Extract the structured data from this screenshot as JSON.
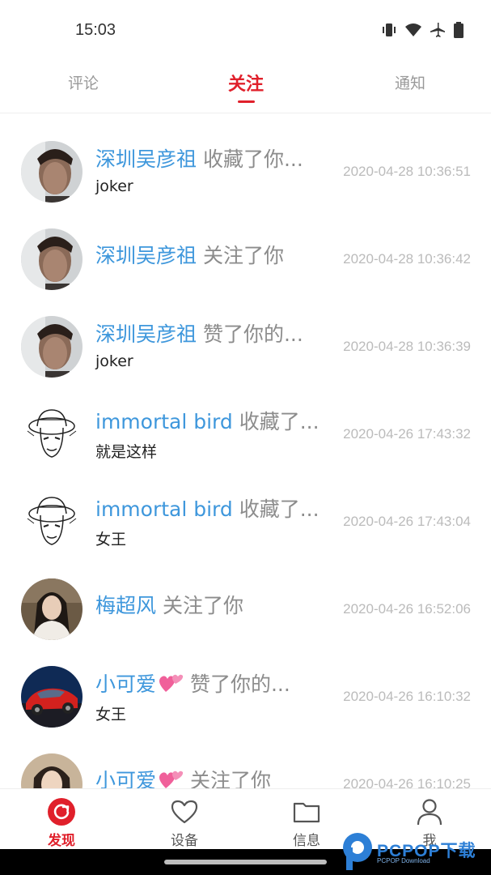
{
  "status_bar": {
    "time": "15:03",
    "icons": [
      "vibrate-icon",
      "wifi-icon",
      "airplane-icon",
      "battery-icon"
    ]
  },
  "tabs": [
    {
      "label": "评论",
      "active": false
    },
    {
      "label": "关注",
      "active": true
    },
    {
      "label": "通知",
      "active": false
    }
  ],
  "items": [
    {
      "avatar": "man-portrait",
      "name": "深圳吴彦祖",
      "action": "收藏了你...",
      "sub": "joker",
      "time": "2020-04-28 10:36:51"
    },
    {
      "avatar": "man-portrait",
      "name": "深圳吴彦祖",
      "action": "关注了你",
      "sub": "",
      "time": "2020-04-28 10:36:42"
    },
    {
      "avatar": "man-portrait",
      "name": "深圳吴彦祖",
      "action": "赞了你的...",
      "sub": "joker",
      "time": "2020-04-28 10:36:39"
    },
    {
      "avatar": "straw-hat-sketch",
      "name": "immortal bird",
      "action": "收藏了...",
      "sub": "就是这样",
      "time": "2020-04-26 17:43:32"
    },
    {
      "avatar": "straw-hat-sketch",
      "name": "immortal bird",
      "action": "收藏了...",
      "sub": "女王",
      "time": "2020-04-26 17:43:04"
    },
    {
      "avatar": "woman-portrait",
      "name": "梅超风",
      "action": "关注了你",
      "sub": "",
      "time": "2020-04-26 16:52:06"
    },
    {
      "avatar": "red-sports-car",
      "name": "小可爱",
      "name_emoji": "two-hearts",
      "action": "赞了你的...",
      "sub": "女王",
      "time": "2020-04-26 16:10:32"
    },
    {
      "avatar": "woman-portrait-2",
      "name": "小可爱",
      "name_emoji": "two-hearts",
      "action": "关注了你",
      "sub": "",
      "time": "2020-04-26 16:10:25"
    }
  ],
  "bottom_nav": [
    {
      "label": "发现",
      "icon": "refresh-icon",
      "active": true
    },
    {
      "label": "设备",
      "icon": "heart-icon",
      "active": false
    },
    {
      "label": "信息",
      "icon": "folder-icon",
      "active": false
    },
    {
      "label": "我",
      "icon": "user-icon",
      "active": false
    }
  ],
  "watermark": {
    "text": "PCPOP下载",
    "sub": "PCPOP Download"
  },
  "colors": {
    "accent": "#e0202b",
    "username": "#3e97dc",
    "action": "#8c8c8c",
    "timestamp": "#bbbbbb"
  }
}
